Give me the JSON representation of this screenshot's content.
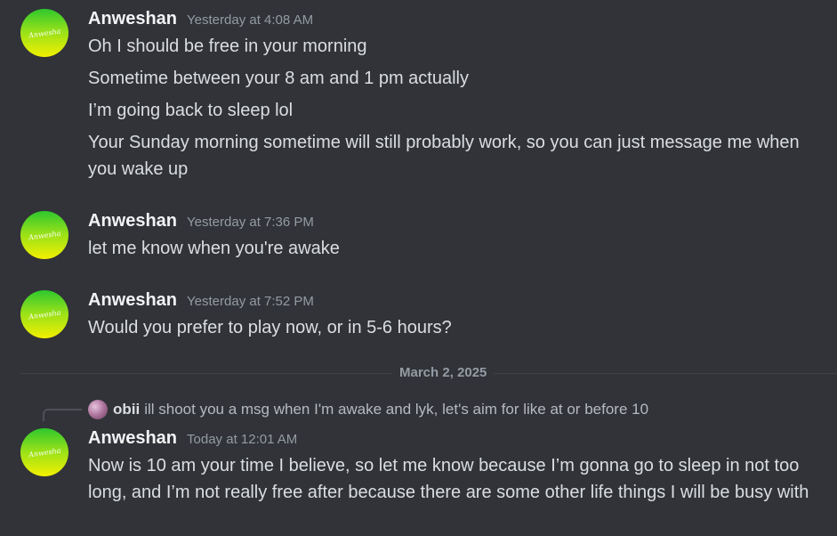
{
  "messages": [
    {
      "username": "Anweshan",
      "timestamp": "Yesterday at 4:08 AM",
      "avatar_text": "Anwesha",
      "lines": [
        "Oh I should be free in your morning",
        "Sometime between your 8 am and 1 pm actually",
        "I’m going back to sleep lol",
        "Your Sunday morning sometime will still probably work, so you can just message me when you wake up"
      ]
    },
    {
      "username": "Anweshan",
      "timestamp": "Yesterday at 7:36 PM",
      "avatar_text": "Anwesha",
      "lines": [
        "let me know when you're awake"
      ]
    },
    {
      "username": "Anweshan",
      "timestamp": "Yesterday at 7:52 PM",
      "avatar_text": "Anwesha",
      "lines": [
        "Would you prefer to play now, or in 5-6 hours?"
      ]
    },
    {
      "username": "Anweshan",
      "timestamp": "Today at 12:01 AM",
      "avatar_text": "Anwesha",
      "reply": {
        "username": "obii",
        "text": "ill shoot you a msg when I'm awake and lyk, let's aim for like at or before 10"
      },
      "lines": [
        "Now is 10 am your time I believe, so let me know because I’m gonna go to sleep in not too long, and I’m not really free after because there are some other life things I will be busy with"
      ]
    }
  ],
  "date_divider": "March 2, 2025",
  "colors": {
    "background": "#313338",
    "username": "#f2f3f5",
    "message_text": "#dbdee1",
    "timestamp": "#949ba4"
  }
}
